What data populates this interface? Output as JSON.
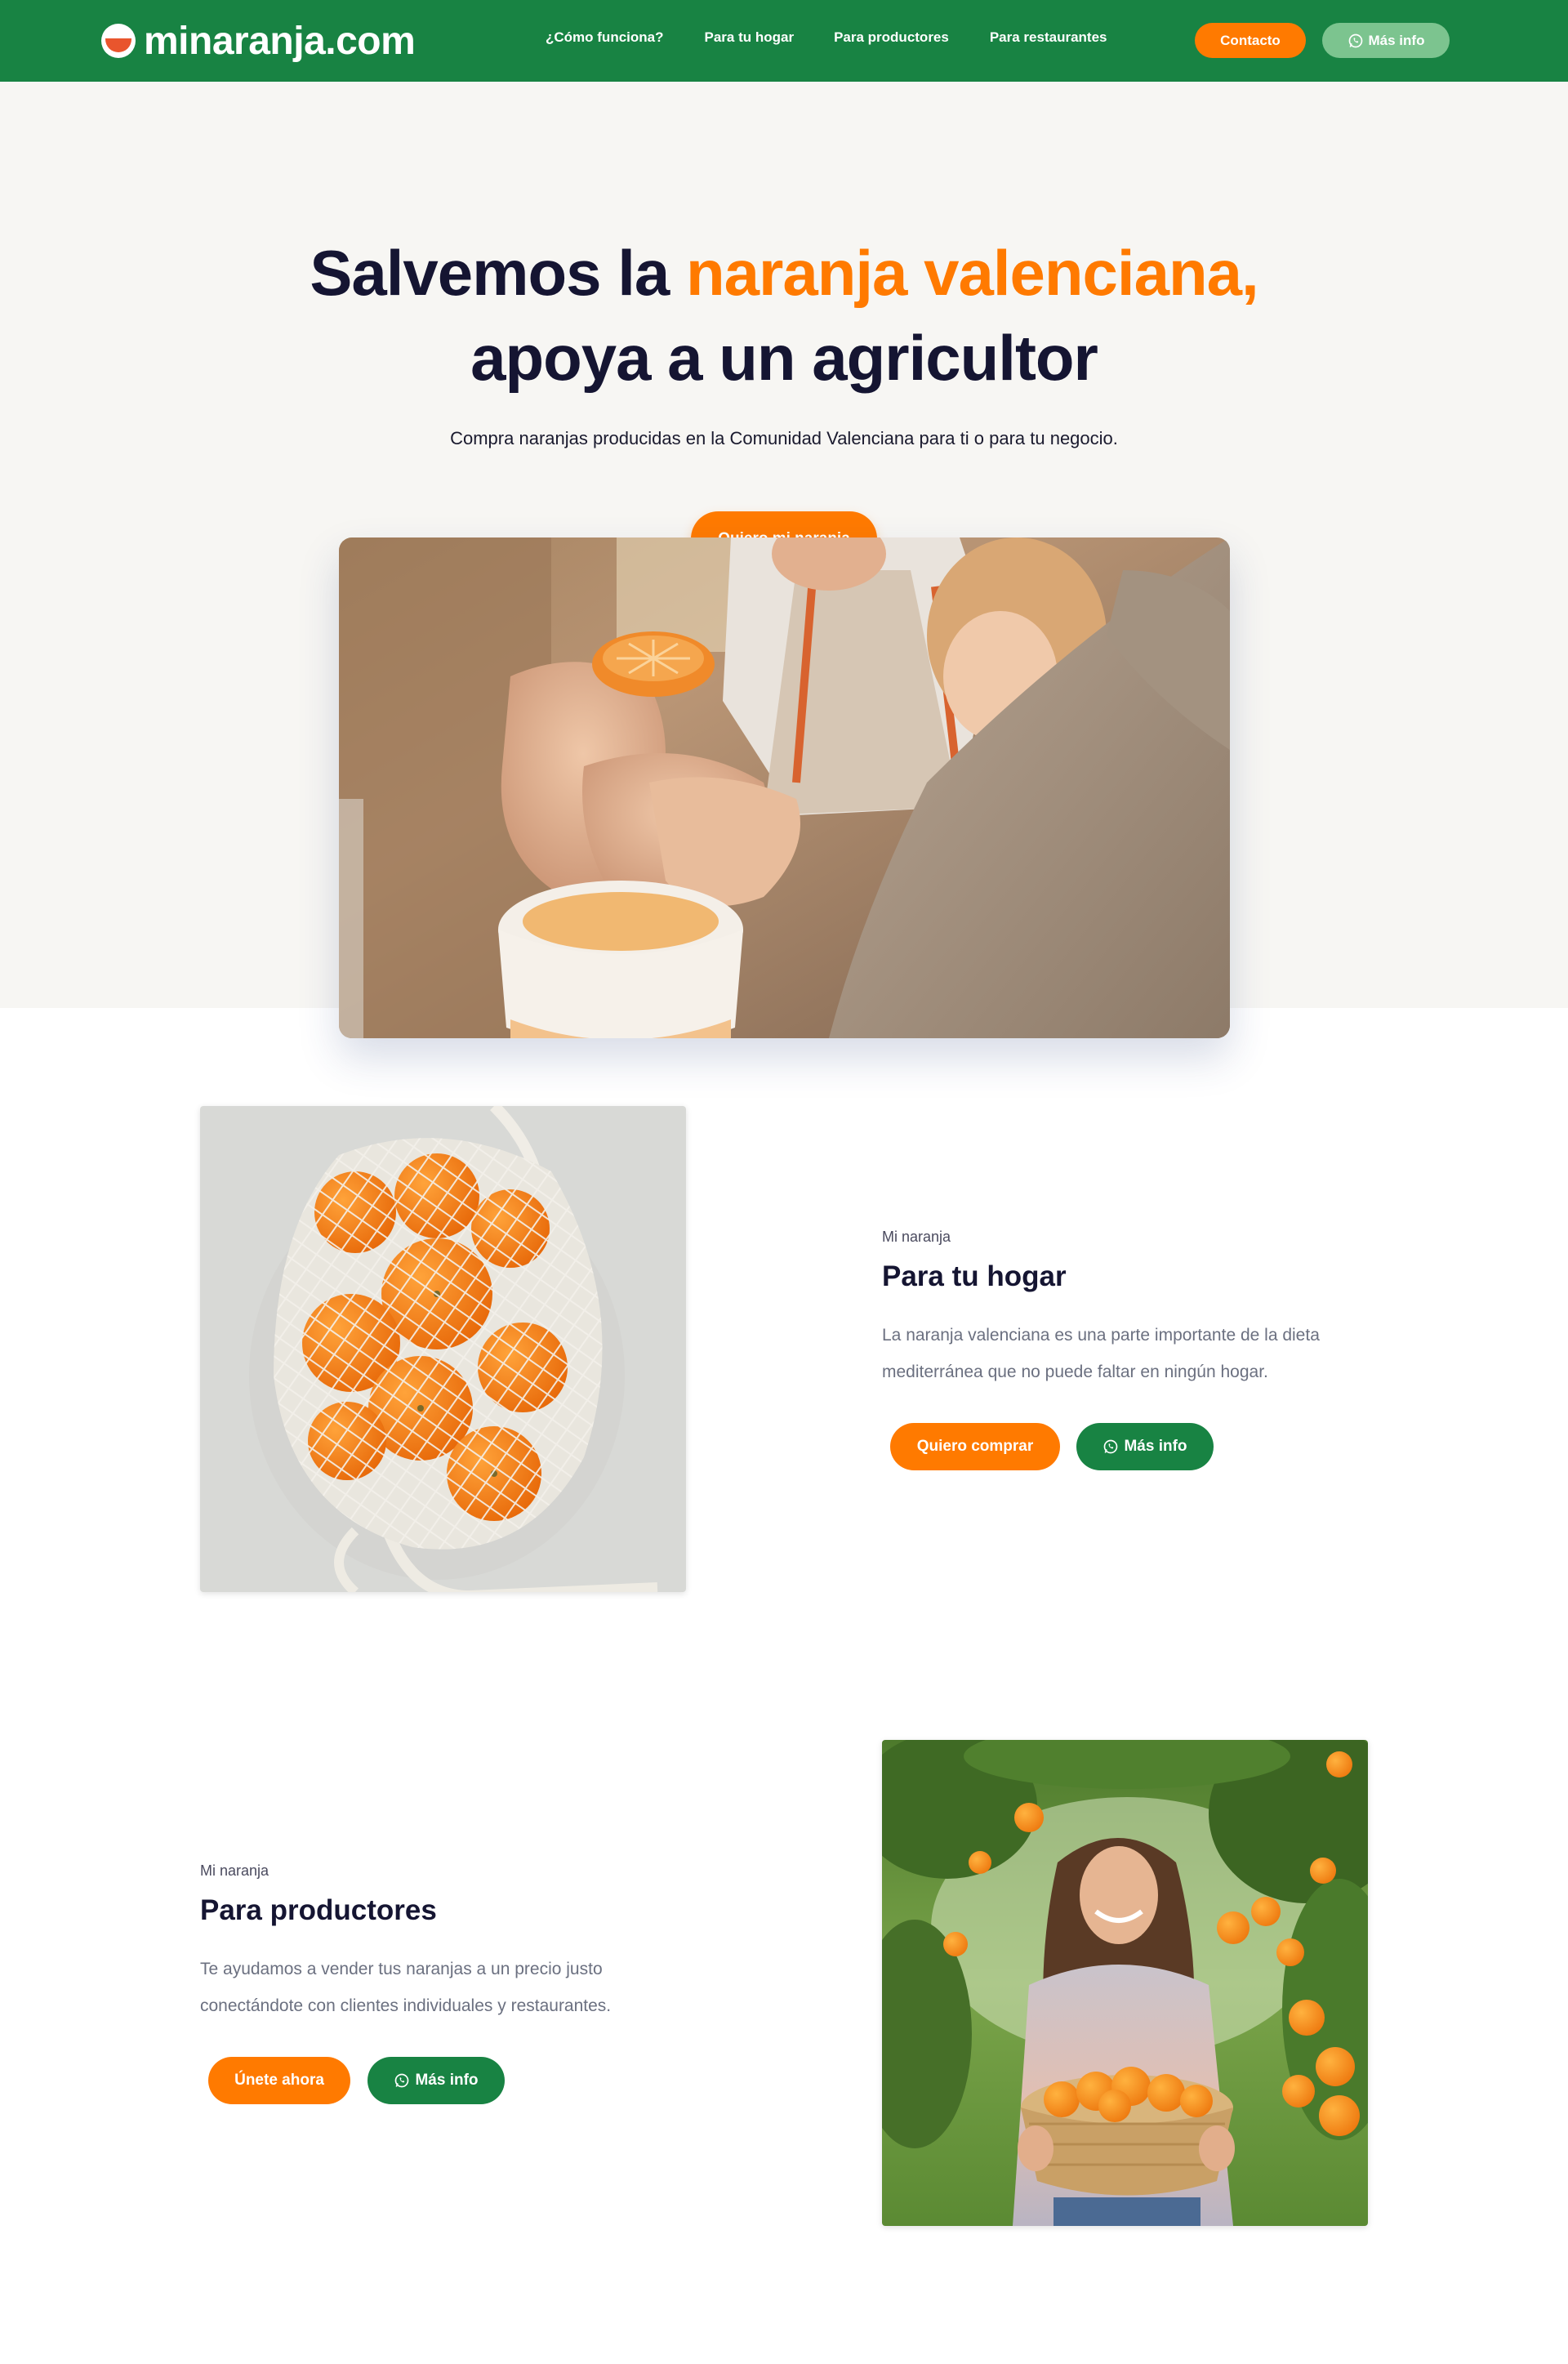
{
  "brand": {
    "name": "minaranja.com"
  },
  "nav": {
    "links": [
      "¿Cómo funciona?",
      "Para tu hogar",
      "Para productores",
      "Para restaurantes"
    ],
    "contact_label": "Contacto",
    "info_label": "Más info"
  },
  "hero": {
    "title_part1": "Salvemos la ",
    "title_accent": "naranja valenciana,",
    "title_line2": "apoya a un agricultor",
    "subtitle": "Compra naranjas producidas en la Comunidad Valenciana para ti o para tu negocio.",
    "cta_label": "Quiero mi naranja"
  },
  "sections": [
    {
      "eyebrow": "Mi naranja",
      "title": "Para tu hogar",
      "text_line1": "La naranja valenciana es una parte importante de la dieta",
      "text_line2": "mediterránea que no puede faltar en ningún hogar.",
      "primary_label": "Quiero comprar",
      "secondary_label": "Más info"
    },
    {
      "eyebrow": "Mi naranja",
      "title": "Para productores",
      "text_line1": "Te ayudamos a vender tus naranjas a un precio justo",
      "text_line2": "conectándote con clientes individuales y restaurantes.",
      "primary_label": "Únete ahora",
      "secondary_label": "Más info"
    }
  ],
  "colors": {
    "brand_green": "#188343",
    "accent_orange": "#ff7a00",
    "title_navy": "#151532",
    "hero_bg": "#f7f6f3"
  },
  "icons": [
    "whatsapp-icon",
    "logo-orange-icon"
  ]
}
